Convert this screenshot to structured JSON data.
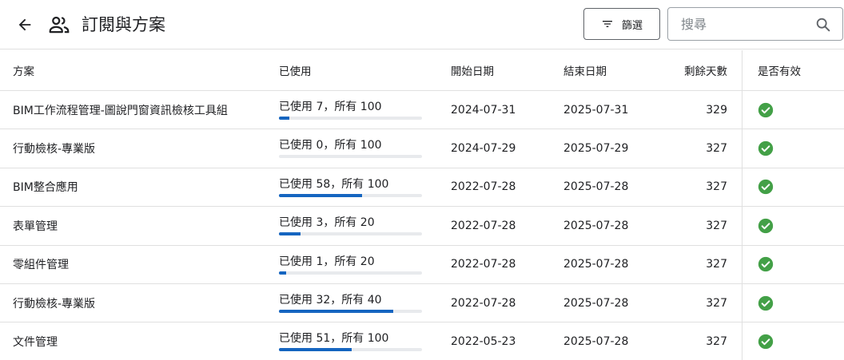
{
  "header": {
    "title": "訂閱與方案",
    "filter_label": "篩選",
    "search_placeholder": "搜尋"
  },
  "columns": {
    "plan": "方案",
    "used": "已使用",
    "start": "開始日期",
    "end": "結束日期",
    "days": "剩餘天數",
    "valid": "是否有效"
  },
  "colors": {
    "progress": "#1565c0",
    "valid": "#43a047"
  },
  "rows": [
    {
      "plan": "BIM工作流程管理-圖說門窗資訊檢核工具組",
      "used_text": "已使用 7，所有 100",
      "used": 7,
      "total": 100,
      "start": "2024-07-31",
      "end": "2025-07-31",
      "days": "329",
      "valid": true
    },
    {
      "plan": "行動檢核-專業版",
      "used_text": "已使用 0，所有 100",
      "used": 0,
      "total": 100,
      "start": "2024-07-29",
      "end": "2025-07-29",
      "days": "327",
      "valid": true
    },
    {
      "plan": "BIM整合應用",
      "used_text": "已使用 58，所有 100",
      "used": 58,
      "total": 100,
      "start": "2022-07-28",
      "end": "2025-07-28",
      "days": "327",
      "valid": true
    },
    {
      "plan": "表單管理",
      "used_text": "已使用 3，所有 20",
      "used": 3,
      "total": 20,
      "start": "2022-07-28",
      "end": "2025-07-28",
      "days": "327",
      "valid": true
    },
    {
      "plan": "零組件管理",
      "used_text": "已使用 1，所有 20",
      "used": 1,
      "total": 20,
      "start": "2022-07-28",
      "end": "2025-07-28",
      "days": "327",
      "valid": true
    },
    {
      "plan": "行動檢核-專業版",
      "used_text": "已使用 32，所有 40",
      "used": 32,
      "total": 40,
      "start": "2022-07-28",
      "end": "2025-07-28",
      "days": "327",
      "valid": true
    },
    {
      "plan": "文件管理",
      "used_text": "已使用 51，所有 100",
      "used": 51,
      "total": 100,
      "start": "2022-05-23",
      "end": "2025-07-28",
      "days": "327",
      "valid": true
    }
  ]
}
